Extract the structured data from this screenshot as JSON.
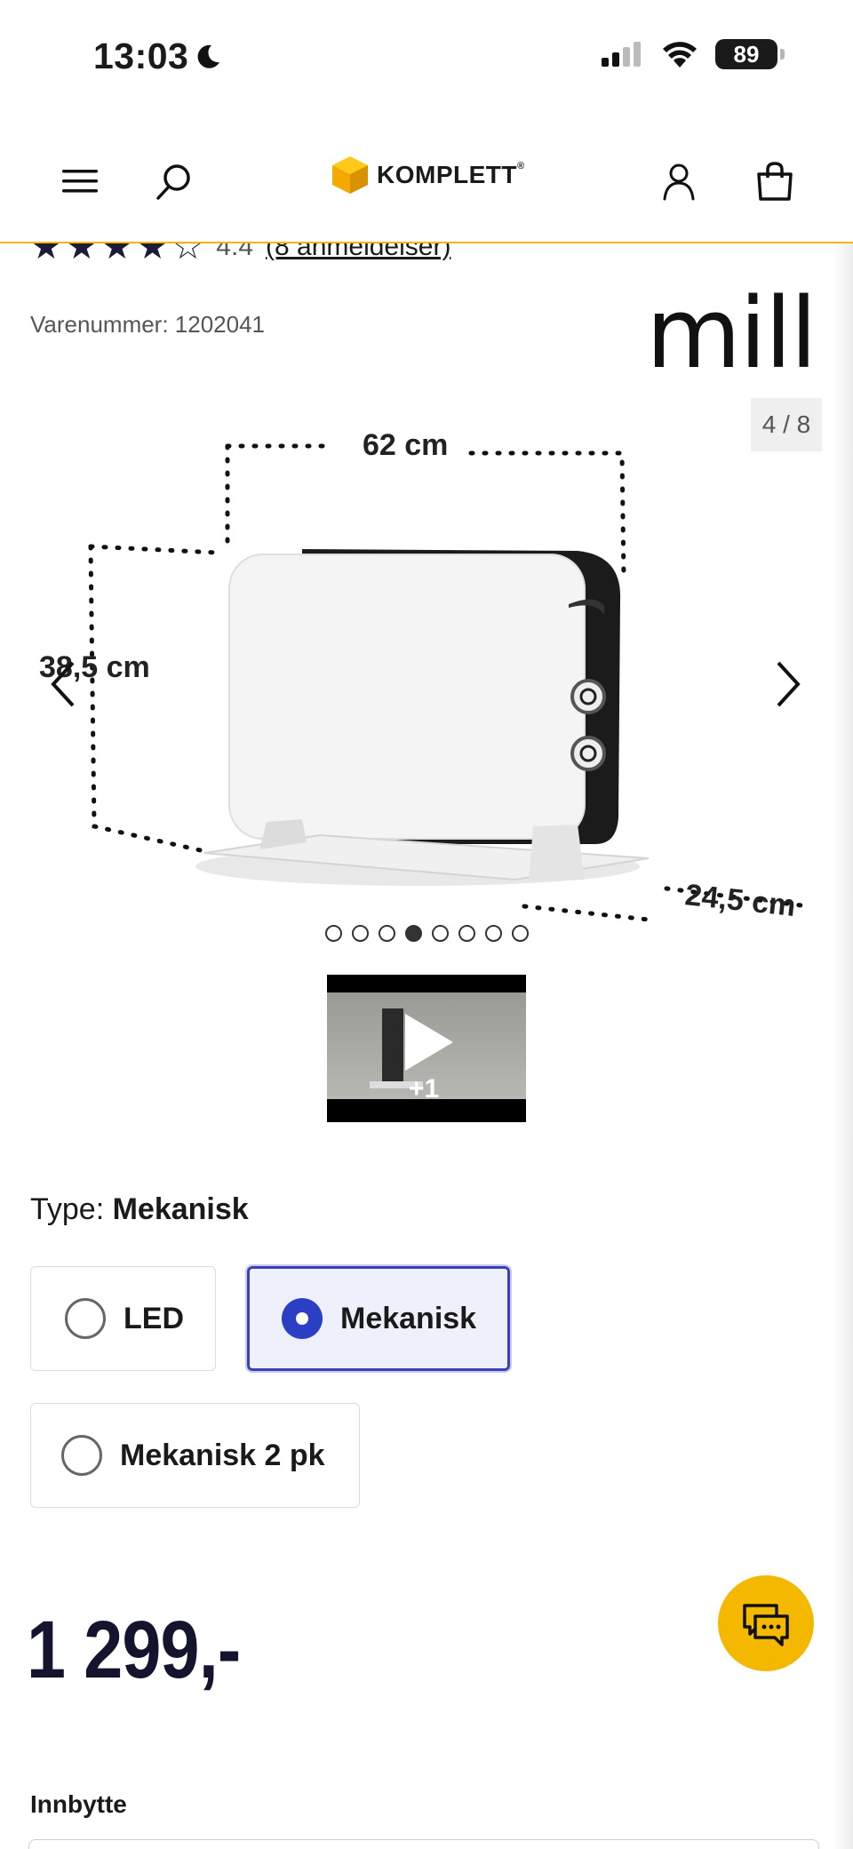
{
  "status_bar": {
    "time": "13:03",
    "battery": "89"
  },
  "header": {
    "logo_text": "KOMPLETT",
    "logo_mark": "®"
  },
  "product": {
    "rating_value": "4.4",
    "rating_link": "(8 anmeldelser)",
    "sku": "Varenummer: 1202041",
    "brand": "mill",
    "image_counter": "4 / 8",
    "image_labels": {
      "width": "62 cm",
      "height": "38,5 cm",
      "depth": "24,5 cm"
    },
    "carousel_total": 8,
    "carousel_active": 4,
    "video_extra": "+1",
    "rating_stars": 4.4
  },
  "type_selector": {
    "label_prefix": "Type: ",
    "label_value": "Mekanisk",
    "options": [
      {
        "label": "LED",
        "selected": false
      },
      {
        "label": "Mekanisk",
        "selected": true
      },
      {
        "label": "Mekanisk 2 pk",
        "selected": false
      }
    ]
  },
  "price": "1 299,-",
  "tradein": {
    "label": "Innbytte"
  },
  "colors": {
    "accent_yellow": "#f5b800",
    "selected_blue": "#2b3fc4",
    "price_navy": "#14142e"
  },
  "icons": [
    "menu-icon",
    "search-icon",
    "user-icon",
    "cart-icon",
    "chevron-left-icon",
    "chevron-right-icon",
    "play-icon",
    "chat-icon"
  ]
}
